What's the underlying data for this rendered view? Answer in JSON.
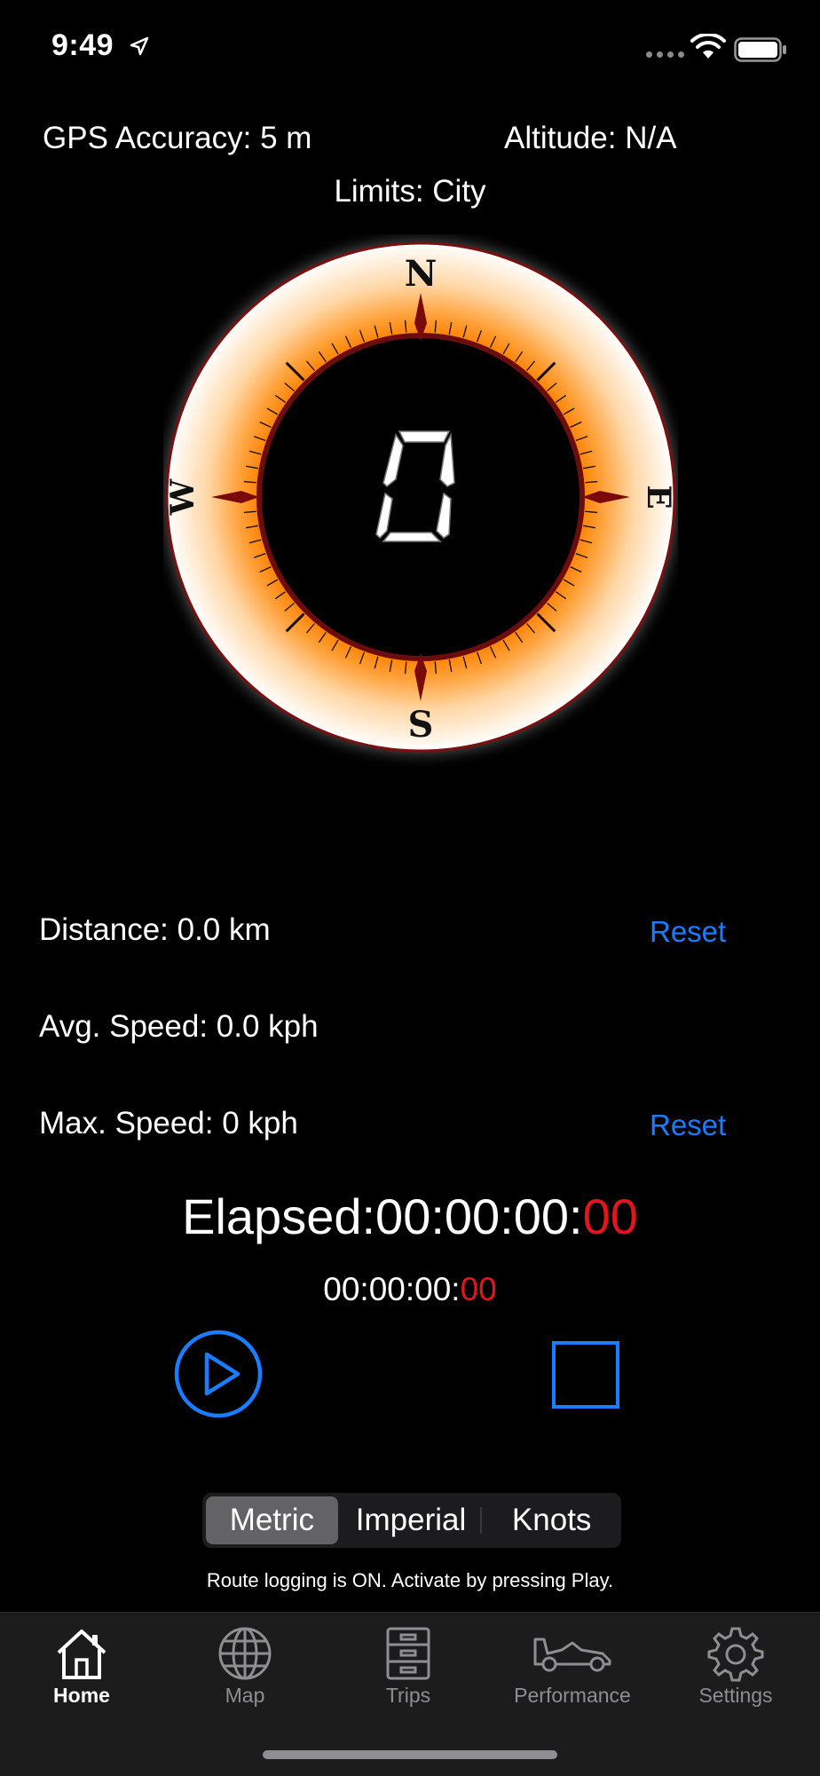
{
  "status": {
    "time": "9:49"
  },
  "info": {
    "gps": "GPS Accuracy: 5 m",
    "altitude": "Altitude: N/A",
    "limits": "Limits: City"
  },
  "gauge": {
    "speed": "0",
    "north": "N",
    "south": "S",
    "east": "E",
    "west": "W"
  },
  "stats": {
    "distance": "Distance: 0.0 km",
    "avg_speed": "Avg. Speed: 0.0 kph",
    "max_speed": "Max. Speed: 0 kph",
    "reset_label": "Reset"
  },
  "timer": {
    "elapsed_label": "Elapsed:",
    "elapsed_main": "00:00:00:",
    "elapsed_frac": "00",
    "small_main": "00:00:00:",
    "small_frac": "00"
  },
  "units": {
    "options": [
      "Metric",
      "Imperial",
      "Knots"
    ],
    "selected": "Metric"
  },
  "route_note": "Route logging is ON. Activate by pressing Play.",
  "tabs": [
    {
      "label": "Home",
      "icon": "house-icon",
      "active": true
    },
    {
      "label": "Map",
      "icon": "globe-icon",
      "active": false
    },
    {
      "label": "Trips",
      "icon": "cabinet-icon",
      "active": false
    },
    {
      "label": "Performance",
      "icon": "race-car-icon",
      "active": false
    },
    {
      "label": "Settings",
      "icon": "gear-icon",
      "active": false
    }
  ],
  "colors": {
    "accent": "#1a7cff",
    "timer_red": "#e0161d",
    "gauge_orange": "#ff9a2e"
  }
}
